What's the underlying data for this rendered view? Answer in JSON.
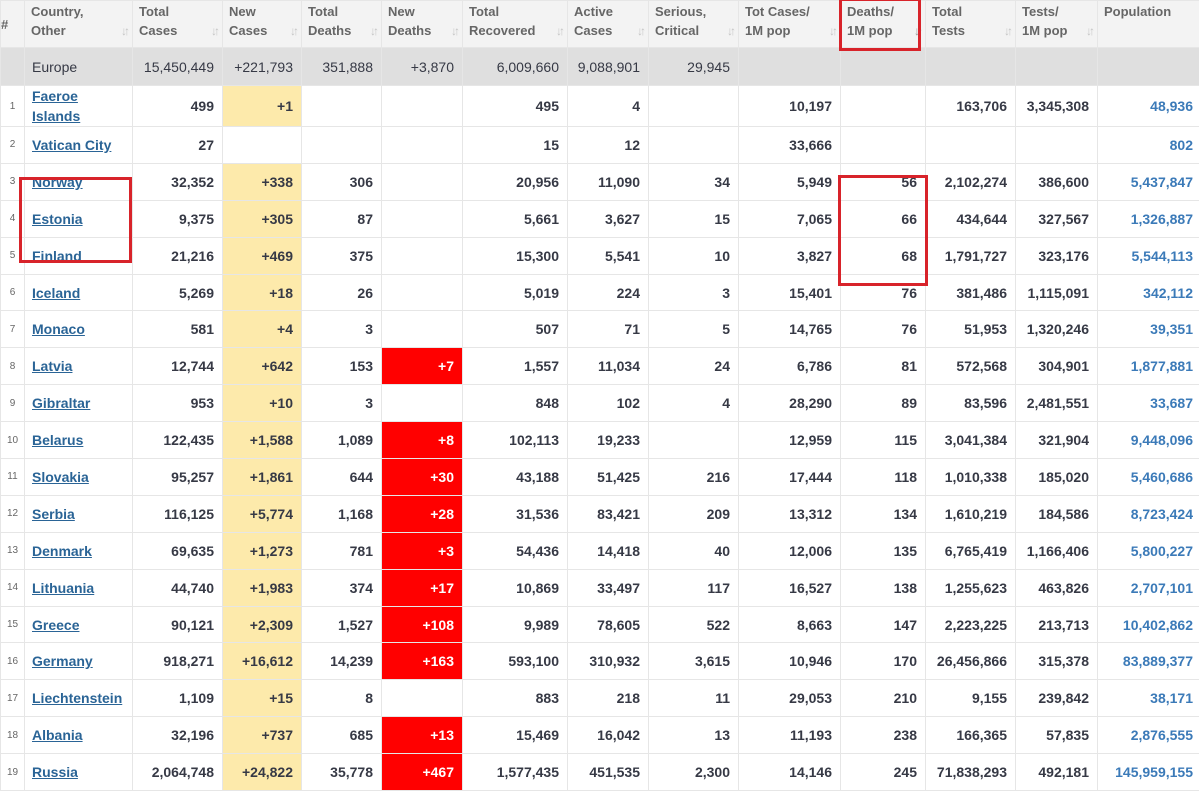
{
  "columns": [
    {
      "label": "#",
      "sortable": false
    },
    {
      "label": "Country,\nOther",
      "sortable": true
    },
    {
      "label": "Total\nCases",
      "sortable": true
    },
    {
      "label": "New\nCases",
      "sortable": true
    },
    {
      "label": "Total\nDeaths",
      "sortable": true
    },
    {
      "label": "New\nDeaths",
      "sortable": true
    },
    {
      "label": "Total\nRecovered",
      "sortable": true
    },
    {
      "label": "Active\nCases",
      "sortable": true
    },
    {
      "label": "Serious,\nCritical",
      "sortable": true
    },
    {
      "label": "Tot Cases/\n1M pop",
      "sortable": true
    },
    {
      "label": "Deaths/\n1M pop",
      "sortable": true,
      "sorted": "asc"
    },
    {
      "label": "Total\nTests",
      "sortable": true
    },
    {
      "label": "Tests/\n1M pop",
      "sortable": true
    },
    {
      "label": "Population",
      "sortable": false
    }
  ],
  "sort_icon_glyph": "↓↑",
  "region": {
    "name": "Europe",
    "total_cases": "15,450,449",
    "new_cases": "+221,793",
    "total_deaths": "351,888",
    "new_deaths": "+3,870",
    "total_recovered": "6,009,660",
    "active_cases": "9,088,901",
    "serious": "29,945",
    "cases_per_1m": "",
    "deaths_per_1m": "",
    "total_tests": "",
    "tests_per_1m": "",
    "population": ""
  },
  "rows": [
    {
      "idx": "1",
      "country": "Faeroe\nIslands",
      "total_cases": "499",
      "new_cases": "+1",
      "total_deaths": "",
      "new_deaths": "",
      "total_recovered": "495",
      "active_cases": "4",
      "serious": "",
      "cases_per_1m": "10,197",
      "deaths_per_1m": "",
      "total_tests": "163,706",
      "tests_per_1m": "3,345,308",
      "population": "48,936"
    },
    {
      "idx": "2",
      "country": "Vatican City",
      "total_cases": "27",
      "new_cases": "",
      "total_deaths": "",
      "new_deaths": "",
      "total_recovered": "15",
      "active_cases": "12",
      "serious": "",
      "cases_per_1m": "33,666",
      "deaths_per_1m": "",
      "total_tests": "",
      "tests_per_1m": "",
      "population": "802"
    },
    {
      "idx": "3",
      "country": "Norway",
      "total_cases": "32,352",
      "new_cases": "+338",
      "total_deaths": "306",
      "new_deaths": "",
      "total_recovered": "20,956",
      "active_cases": "11,090",
      "serious": "34",
      "cases_per_1m": "5,949",
      "deaths_per_1m": "56",
      "total_tests": "2,102,274",
      "tests_per_1m": "386,600",
      "population": "5,437,847"
    },
    {
      "idx": "4",
      "country": "Estonia",
      "total_cases": "9,375",
      "new_cases": "+305",
      "total_deaths": "87",
      "new_deaths": "",
      "total_recovered": "5,661",
      "active_cases": "3,627",
      "serious": "15",
      "cases_per_1m": "7,065",
      "deaths_per_1m": "66",
      "total_tests": "434,644",
      "tests_per_1m": "327,567",
      "population": "1,326,887"
    },
    {
      "idx": "5",
      "country": "Finland",
      "total_cases": "21,216",
      "new_cases": "+469",
      "total_deaths": "375",
      "new_deaths": "",
      "total_recovered": "15,300",
      "active_cases": "5,541",
      "serious": "10",
      "cases_per_1m": "3,827",
      "deaths_per_1m": "68",
      "total_tests": "1,791,727",
      "tests_per_1m": "323,176",
      "population": "5,544,113"
    },
    {
      "idx": "6",
      "country": "Iceland",
      "total_cases": "5,269",
      "new_cases": "+18",
      "total_deaths": "26",
      "new_deaths": "",
      "total_recovered": "5,019",
      "active_cases": "224",
      "serious": "3",
      "cases_per_1m": "15,401",
      "deaths_per_1m": "76",
      "total_tests": "381,486",
      "tests_per_1m": "1,115,091",
      "population": "342,112"
    },
    {
      "idx": "7",
      "country": "Monaco",
      "total_cases": "581",
      "new_cases": "+4",
      "total_deaths": "3",
      "new_deaths": "",
      "total_recovered": "507",
      "active_cases": "71",
      "serious": "5",
      "cases_per_1m": "14,765",
      "deaths_per_1m": "76",
      "total_tests": "51,953",
      "tests_per_1m": "1,320,246",
      "population": "39,351"
    },
    {
      "idx": "8",
      "country": "Latvia",
      "total_cases": "12,744",
      "new_cases": "+642",
      "total_deaths": "153",
      "new_deaths": "+7",
      "total_recovered": "1,557",
      "active_cases": "11,034",
      "serious": "24",
      "cases_per_1m": "6,786",
      "deaths_per_1m": "81",
      "total_tests": "572,568",
      "tests_per_1m": "304,901",
      "population": "1,877,881"
    },
    {
      "idx": "9",
      "country": "Gibraltar",
      "total_cases": "953",
      "new_cases": "+10",
      "total_deaths": "3",
      "new_deaths": "",
      "total_recovered": "848",
      "active_cases": "102",
      "serious": "4",
      "cases_per_1m": "28,290",
      "deaths_per_1m": "89",
      "total_tests": "83,596",
      "tests_per_1m": "2,481,551",
      "population": "33,687"
    },
    {
      "idx": "10",
      "country": "Belarus",
      "total_cases": "122,435",
      "new_cases": "+1,588",
      "total_deaths": "1,089",
      "new_deaths": "+8",
      "total_recovered": "102,113",
      "active_cases": "19,233",
      "serious": "",
      "cases_per_1m": "12,959",
      "deaths_per_1m": "115",
      "total_tests": "3,041,384",
      "tests_per_1m": "321,904",
      "population": "9,448,096"
    },
    {
      "idx": "11",
      "country": "Slovakia",
      "total_cases": "95,257",
      "new_cases": "+1,861",
      "total_deaths": "644",
      "new_deaths": "+30",
      "total_recovered": "43,188",
      "active_cases": "51,425",
      "serious": "216",
      "cases_per_1m": "17,444",
      "deaths_per_1m": "118",
      "total_tests": "1,010,338",
      "tests_per_1m": "185,020",
      "population": "5,460,686"
    },
    {
      "idx": "12",
      "country": "Serbia",
      "total_cases": "116,125",
      "new_cases": "+5,774",
      "total_deaths": "1,168",
      "new_deaths": "+28",
      "total_recovered": "31,536",
      "active_cases": "83,421",
      "serious": "209",
      "cases_per_1m": "13,312",
      "deaths_per_1m": "134",
      "total_tests": "1,610,219",
      "tests_per_1m": "184,586",
      "population": "8,723,424"
    },
    {
      "idx": "13",
      "country": "Denmark",
      "total_cases": "69,635",
      "new_cases": "+1,273",
      "total_deaths": "781",
      "new_deaths": "+3",
      "total_recovered": "54,436",
      "active_cases": "14,418",
      "serious": "40",
      "cases_per_1m": "12,006",
      "deaths_per_1m": "135",
      "total_tests": "6,765,419",
      "tests_per_1m": "1,166,406",
      "population": "5,800,227"
    },
    {
      "idx": "14",
      "country": "Lithuania",
      "total_cases": "44,740",
      "new_cases": "+1,983",
      "total_deaths": "374",
      "new_deaths": "+17",
      "total_recovered": "10,869",
      "active_cases": "33,497",
      "serious": "117",
      "cases_per_1m": "16,527",
      "deaths_per_1m": "138",
      "total_tests": "1,255,623",
      "tests_per_1m": "463,826",
      "population": "2,707,101"
    },
    {
      "idx": "15",
      "country": "Greece",
      "total_cases": "90,121",
      "new_cases": "+2,309",
      "total_deaths": "1,527",
      "new_deaths": "+108",
      "total_recovered": "9,989",
      "active_cases": "78,605",
      "serious": "522",
      "cases_per_1m": "8,663",
      "deaths_per_1m": "147",
      "total_tests": "2,223,225",
      "tests_per_1m": "213,713",
      "population": "10,402,862"
    },
    {
      "idx": "16",
      "country": "Germany",
      "total_cases": "918,271",
      "new_cases": "+16,612",
      "total_deaths": "14,239",
      "new_deaths": "+163",
      "total_recovered": "593,100",
      "active_cases": "310,932",
      "serious": "3,615",
      "cases_per_1m": "10,946",
      "deaths_per_1m": "170",
      "total_tests": "26,456,866",
      "tests_per_1m": "315,378",
      "population": "83,889,377"
    },
    {
      "idx": "17",
      "country": "Liechtenstein",
      "total_cases": "1,109",
      "new_cases": "+15",
      "total_deaths": "8",
      "new_deaths": "",
      "total_recovered": "883",
      "active_cases": "218",
      "serious": "11",
      "cases_per_1m": "29,053",
      "deaths_per_1m": "210",
      "total_tests": "9,155",
      "tests_per_1m": "239,842",
      "population": "38,171"
    },
    {
      "idx": "18",
      "country": "Albania",
      "total_cases": "32,196",
      "new_cases": "+737",
      "total_deaths": "685",
      "new_deaths": "+13",
      "total_recovered": "15,469",
      "active_cases": "16,042",
      "serious": "13",
      "cases_per_1m": "11,193",
      "deaths_per_1m": "238",
      "total_tests": "166,365",
      "tests_per_1m": "57,835",
      "population": "2,876,555"
    },
    {
      "idx": "19",
      "country": "Russia",
      "total_cases": "2,064,748",
      "new_cases": "+24,822",
      "total_deaths": "35,778",
      "new_deaths": "+467",
      "total_recovered": "1,577,435",
      "active_cases": "451,535",
      "serious": "2,300",
      "cases_per_1m": "14,146",
      "deaths_per_1m": "245",
      "total_tests": "71,838,293",
      "tests_per_1m": "492,181",
      "population": "145,959,155"
    }
  ],
  "colors": {
    "highlight_box": "#d8232a",
    "new_cases_bg": "#fdeaab",
    "new_deaths_bg": "#ff0000",
    "link": "#2a6496",
    "population_text": "#3b7ab8",
    "region_bg": "#dfdfdf",
    "header_bg": "#f3f3f3"
  }
}
